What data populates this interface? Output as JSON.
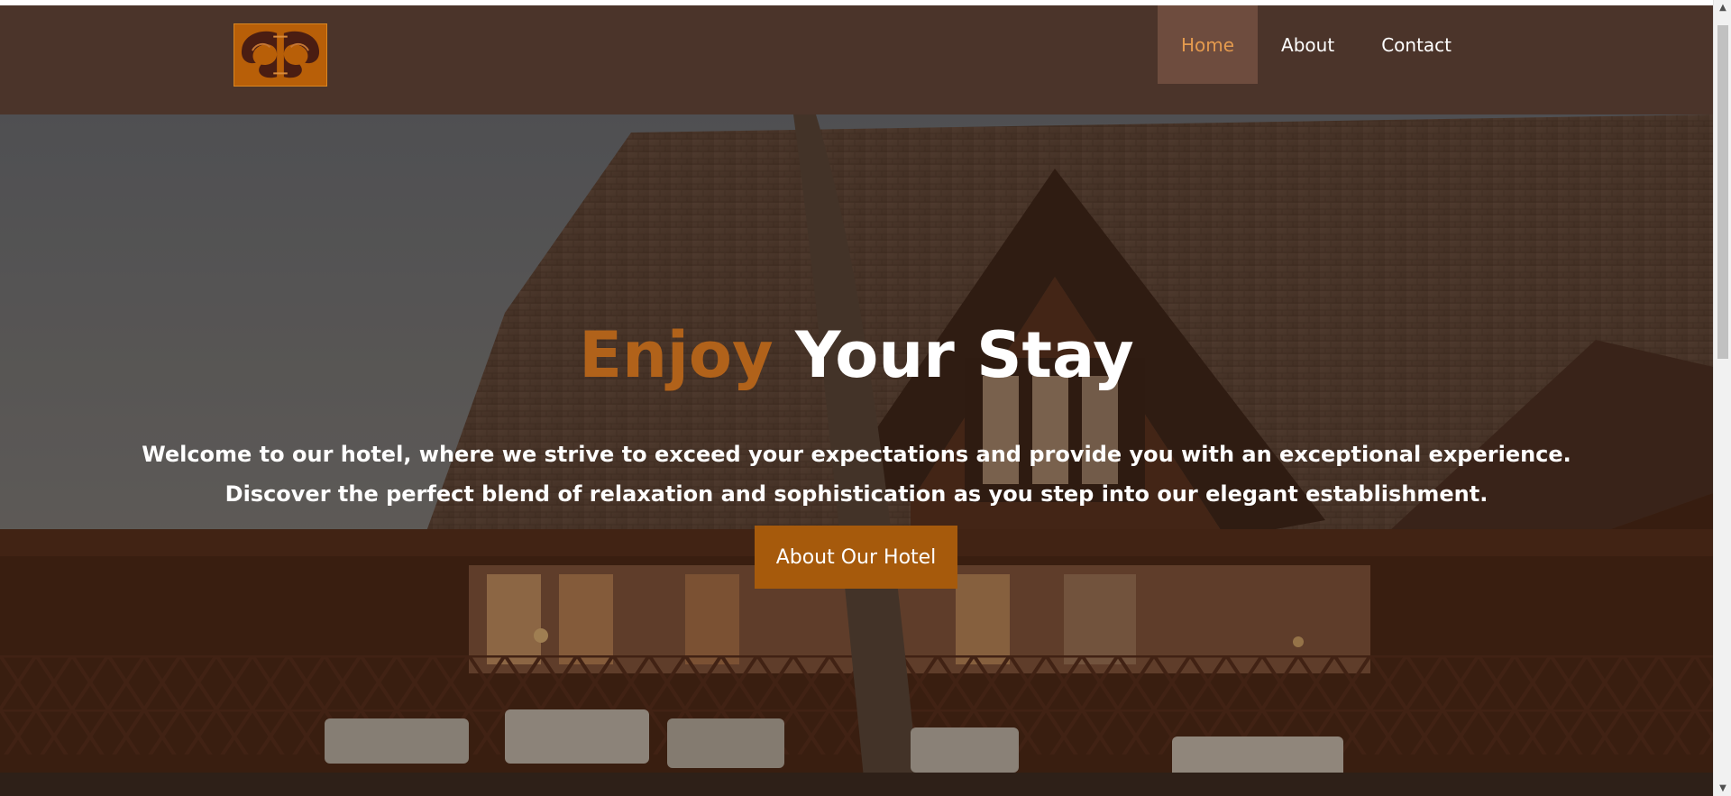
{
  "nav": {
    "items": [
      {
        "label": "Home",
        "active": true
      },
      {
        "label": "About",
        "active": false
      },
      {
        "label": "Contact",
        "active": false
      }
    ]
  },
  "hero": {
    "title_accent": "Enjoy",
    "title_rest": "Your Stay",
    "lines": [
      "Welcome to our hotel, where we strive to exceed your expectations and provide you with an exceptional experience.",
      "Discover the perfect blend of relaxation and sophistication as you step into our elegant establishment."
    ],
    "button_label": "About Our Hotel"
  },
  "scrollbar": {
    "up_icon": "▲",
    "down_icon": "▼"
  },
  "colors": {
    "navbar": "#4b342a",
    "nav_active_bg": "#6e4c3e",
    "nav_active_text": "#e49a4e",
    "accent": "#b1621a",
    "button": "#a65a0c"
  }
}
